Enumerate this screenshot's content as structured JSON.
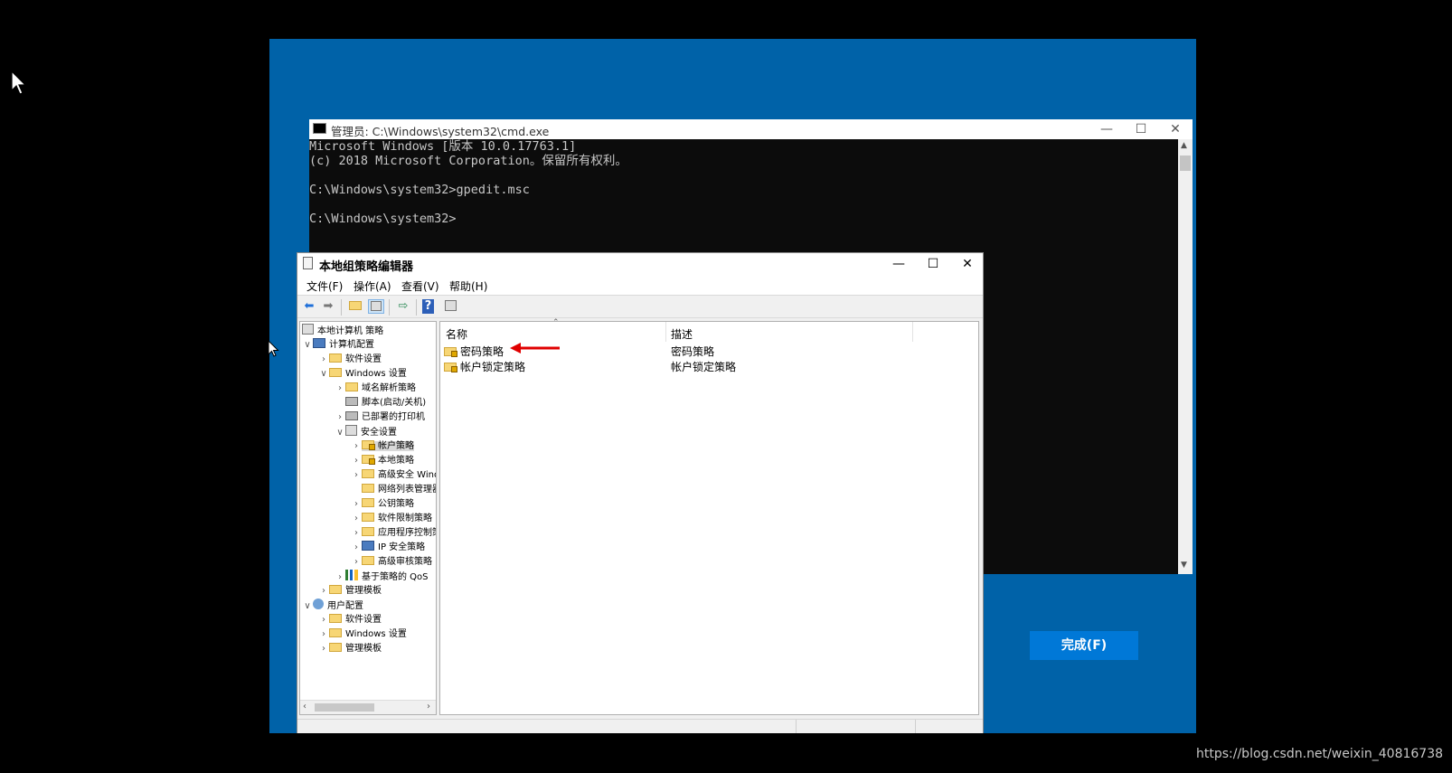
{
  "setup": {
    "finish_label": "完成(F)",
    "bg_color": "#0062a8"
  },
  "cmd": {
    "title": "管理员: C:\\Windows\\system32\\cmd.exe",
    "lines": [
      "Microsoft Windows [版本 10.0.17763.1]",
      "(c) 2018 Microsoft Corporation。保留所有权利。",
      "",
      "C:\\Windows\\system32>gpedit.msc",
      "",
      "C:\\Windows\\system32>"
    ]
  },
  "gpedit": {
    "title": "本地组策略编辑器",
    "menu": [
      "文件(F)",
      "操作(A)",
      "查看(V)",
      "帮助(H)"
    ],
    "tree": [
      {
        "label": "本地计算机 策略",
        "icon": "policy-icon"
      },
      {
        "label": "计算机配置",
        "icon": "computer-icon"
      },
      {
        "label": "软件设置",
        "icon": "folder-icon"
      },
      {
        "label": "Windows 设置",
        "icon": "folder-icon"
      },
      {
        "label": "域名解析策略",
        "icon": "folder-icon"
      },
      {
        "label": "脚本(启动/关机)",
        "icon": "script-icon"
      },
      {
        "label": "已部署的打印机",
        "icon": "printer-icon"
      },
      {
        "label": "安全设置",
        "icon": "security-icon"
      },
      {
        "label": "帐户策略",
        "icon": "folder-lock-icon"
      },
      {
        "label": "本地策略",
        "icon": "folder-lock-icon"
      },
      {
        "label": "高级安全 Windows",
        "icon": "folder-icon"
      },
      {
        "label": "网络列表管理器",
        "icon": "folder-icon"
      },
      {
        "label": "公钥策略",
        "icon": "folder-icon"
      },
      {
        "label": "软件限制策略",
        "icon": "folder-icon"
      },
      {
        "label": "应用程序控制策略",
        "icon": "folder-icon"
      },
      {
        "label": "IP 安全策略",
        "icon": "ip-security-icon"
      },
      {
        "label": "高级审核策略",
        "icon": "folder-icon"
      },
      {
        "label": "基于策略的 QoS",
        "icon": "bar-chart-icon"
      },
      {
        "label": "管理模板",
        "icon": "folder-icon"
      },
      {
        "label": "用户配置",
        "icon": "user-icon"
      },
      {
        "label": "软件设置",
        "icon": "folder-icon"
      },
      {
        "label": "Windows 设置",
        "icon": "folder-icon"
      },
      {
        "label": "管理模板",
        "icon": "folder-icon"
      }
    ],
    "columns": [
      "名称",
      "描述"
    ],
    "rows": [
      {
        "name": "密码策略",
        "desc": "密码策略"
      },
      {
        "name": "帐户锁定策略",
        "desc": "帐户锁定策略"
      }
    ]
  },
  "watermark": "https://blog.csdn.net/weixin_40816738",
  "colors": {
    "arrow": "#e00000",
    "accent": "#0078d7"
  }
}
